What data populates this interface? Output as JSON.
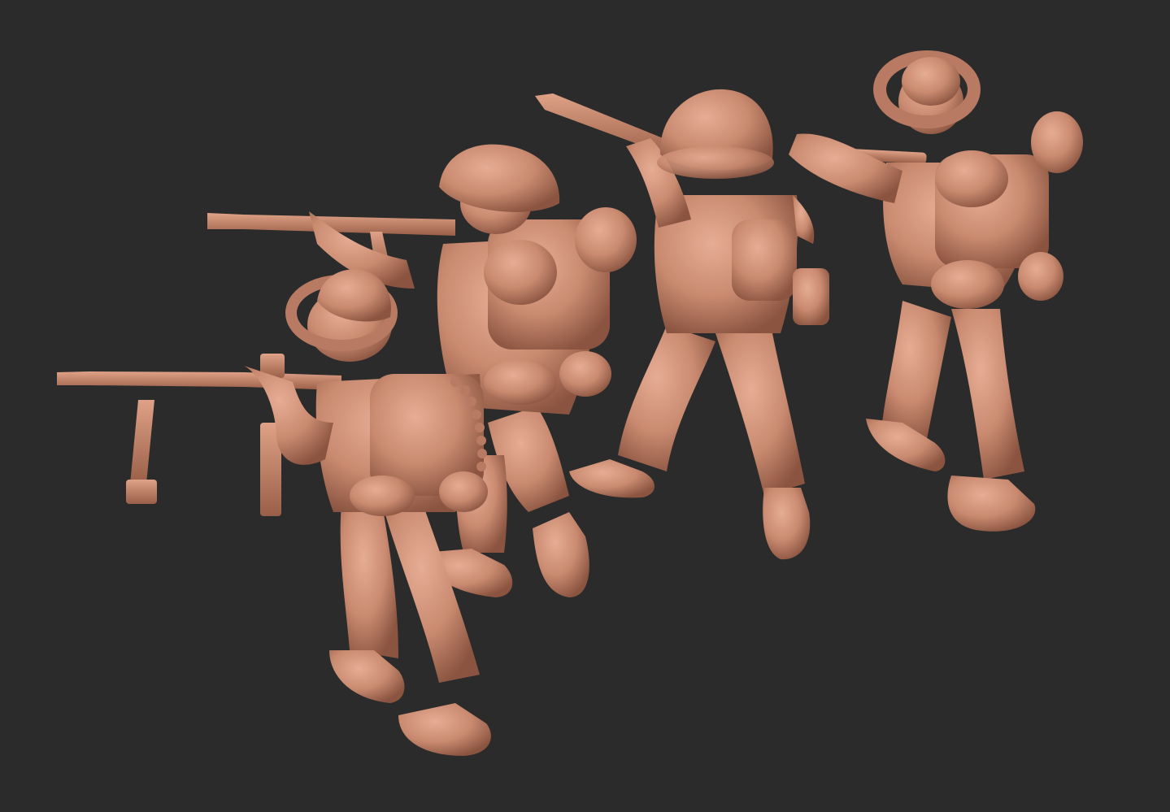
{
  "scene": {
    "background_color": "#2b2b2b",
    "material_color": "#c98a70",
    "material_shadow_color": "#7a4a38",
    "material_highlight_color": "#e8b29a",
    "figures": [
      {
        "name": "soldier-with-submachine-gun",
        "headgear": "boonie-hat",
        "weapon": "submachine-gun"
      },
      {
        "name": "soldier-with-assault-rifle",
        "headgear": "pith-helmet",
        "weapon": "assault-rifle"
      },
      {
        "name": "soldier-with-bolt-rifle",
        "headgear": "steel-helmet",
        "weapon": "rifle"
      },
      {
        "name": "soldier-with-boonie-hat",
        "headgear": "boonie-hat",
        "weapon": "rifle"
      }
    ]
  }
}
